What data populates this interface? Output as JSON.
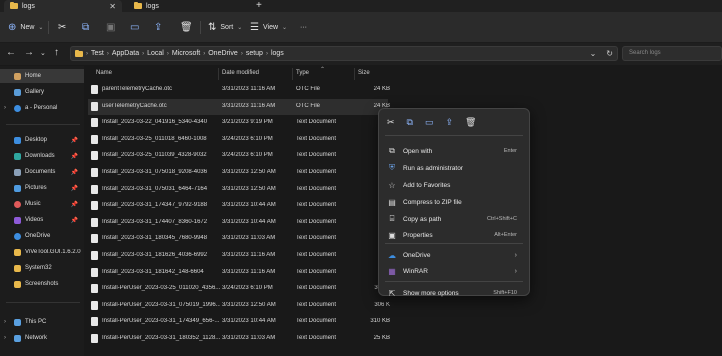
{
  "tabs": [
    {
      "label": "logs"
    },
    {
      "label": "logs"
    }
  ],
  "toolbar": {
    "new_label": "New",
    "sort_label": "Sort",
    "view_label": "View",
    "more_label": "···"
  },
  "breadcrumb": [
    "Test",
    "AppData",
    "Local",
    "Microsoft",
    "OneDrive",
    "setup",
    "logs"
  ],
  "search": {
    "placeholder": "Search logs"
  },
  "sidebar": {
    "items": [
      {
        "label": "Home",
        "icon": "home-icon"
      },
      {
        "label": "Gallery",
        "icon": "gallery-icon"
      },
      {
        "label": "a - Personal",
        "icon": "cloud-icon"
      },
      {
        "label": "Desktop",
        "icon": "desktop-icon"
      },
      {
        "label": "Downloads",
        "icon": "download-icon"
      },
      {
        "label": "Documents",
        "icon": "documents-icon"
      },
      {
        "label": "Pictures",
        "icon": "pictures-icon"
      },
      {
        "label": "Music",
        "icon": "music-icon"
      },
      {
        "label": "Videos",
        "icon": "videos-icon"
      },
      {
        "label": "OneDrive",
        "icon": "cloud-icon"
      },
      {
        "label": "ViVeTool.GUI.1.6.2.0",
        "icon": "folder-icon"
      },
      {
        "label": "System32",
        "icon": "folder-icon"
      },
      {
        "label": "Screenshots",
        "icon": "folder-icon"
      },
      {
        "label": "This PC",
        "icon": "pc-icon"
      },
      {
        "label": "Network",
        "icon": "network-icon"
      }
    ]
  },
  "columns": {
    "name": "Name",
    "date": "Date modified",
    "type": "Type",
    "size": "Size"
  },
  "files": [
    {
      "name": "parentTelemetryCache.otc",
      "date": "3/31/2023 11:16 AM",
      "type": "OTC File",
      "size": "24 KB"
    },
    {
      "name": "userTelemetryCache.otc",
      "date": "3/31/2023 11:16 AM",
      "type": "OTC File",
      "size": "24 KB"
    },
    {
      "name": "Install_2023-03-22_041916_5340-4340",
      "date": "3/21/2023 9:19 PM",
      "type": "Text Document",
      "size": ""
    },
    {
      "name": "Install_2023-03-25_011018_6460-1008",
      "date": "3/24/2023 6:10 PM",
      "type": "Text Document",
      "size": ""
    },
    {
      "name": "Install_2023-03-25_011039_4328-9032",
      "date": "3/24/2023 6:10 PM",
      "type": "Text Document",
      "size": ""
    },
    {
      "name": "Install_2023-03-31_075018_9208-4036",
      "date": "3/31/2023 12:50 AM",
      "type": "Text Document",
      "size": ""
    },
    {
      "name": "Install_2023-03-31_075031_6464-7164",
      "date": "3/31/2023 12:50 AM",
      "type": "Text Document",
      "size": ""
    },
    {
      "name": "Install_2023-03-31_174347_9792-9188",
      "date": "3/31/2023 10:44 AM",
      "type": "Text Document",
      "size": ""
    },
    {
      "name": "Install_2023-03-31_174407_8360-1672",
      "date": "3/31/2023 10:44 AM",
      "type": "Text Document",
      "size": ""
    },
    {
      "name": "Install_2023-03-31_180345_7680-9948",
      "date": "3/31/2023 11:03 AM",
      "type": "Text Document",
      "size": ""
    },
    {
      "name": "Install_2023-03-31_181626_4036-6992",
      "date": "3/31/2023 11:16 AM",
      "type": "Text Document",
      "size": ""
    },
    {
      "name": "Install_2023-03-31_181642_148-6604",
      "date": "3/31/2023 11:16 AM",
      "type": "Text Document",
      "size": ""
    },
    {
      "name": "Install-PerUser_2023-03-25_011020_4356...",
      "date": "3/24/2023 6:10 PM",
      "type": "Text Document",
      "size": "305 K"
    },
    {
      "name": "Install-PerUser_2023-03-31_075019_1996...",
      "date": "3/31/2023 12:50 AM",
      "type": "Text Document",
      "size": "306 K"
    },
    {
      "name": "Install-PerUser_2023-03-31_174349_656-...",
      "date": "3/31/2023 10:44 AM",
      "type": "Text Document",
      "size": "310 KB"
    },
    {
      "name": "Install-PerUser_2023-03-31_180352_1128...",
      "date": "3/31/2023 11:03 AM",
      "type": "Text Document",
      "size": "25 KB"
    }
  ],
  "context_menu": {
    "items": [
      {
        "label": "Open with",
        "shortcut": "Enter",
        "icon": "open-with-icon",
        "submenu": false
      },
      {
        "label": "Run as administrator",
        "shortcut": "",
        "icon": "shield-icon",
        "submenu": false
      },
      {
        "label": "Add to Favorites",
        "shortcut": "",
        "icon": "star-icon",
        "submenu": false
      },
      {
        "label": "Compress to ZIP file",
        "shortcut": "",
        "icon": "zip-icon",
        "submenu": false
      },
      {
        "label": "Copy as path",
        "shortcut": "Ctrl+Shift+C",
        "icon": "copy-path-icon",
        "submenu": false
      },
      {
        "label": "Properties",
        "shortcut": "Alt+Enter",
        "icon": "properties-icon",
        "submenu": false
      },
      {
        "label": "OneDrive",
        "shortcut": "",
        "icon": "cloud-icon",
        "submenu": true
      },
      {
        "label": "WinRAR",
        "shortcut": "",
        "icon": "winrar-icon",
        "submenu": true
      },
      {
        "label": "Show more options",
        "shortcut": "Shift+F10",
        "icon": "more-options-icon",
        "submenu": false
      }
    ]
  },
  "colors": {
    "accent": "#8fb8ff",
    "folder": "#e8b84b",
    "background": "#191919"
  }
}
